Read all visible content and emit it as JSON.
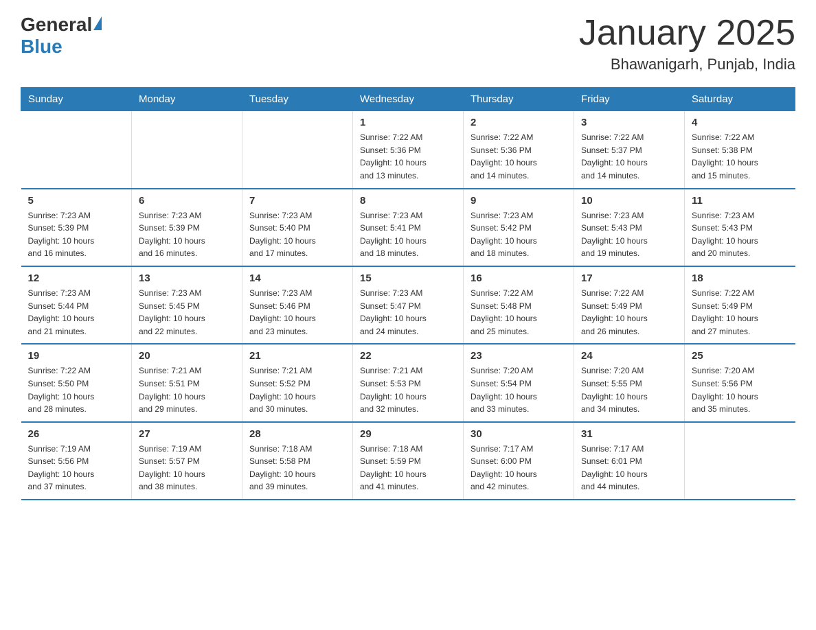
{
  "header": {
    "logo_general": "General",
    "logo_blue": "Blue",
    "month_title": "January 2025",
    "location": "Bhawanigarh, Punjab, India"
  },
  "weekdays": [
    "Sunday",
    "Monday",
    "Tuesday",
    "Wednesday",
    "Thursday",
    "Friday",
    "Saturday"
  ],
  "weeks": [
    [
      {
        "day": "",
        "info": ""
      },
      {
        "day": "",
        "info": ""
      },
      {
        "day": "",
        "info": ""
      },
      {
        "day": "1",
        "info": "Sunrise: 7:22 AM\nSunset: 5:36 PM\nDaylight: 10 hours\nand 13 minutes."
      },
      {
        "day": "2",
        "info": "Sunrise: 7:22 AM\nSunset: 5:36 PM\nDaylight: 10 hours\nand 14 minutes."
      },
      {
        "day": "3",
        "info": "Sunrise: 7:22 AM\nSunset: 5:37 PM\nDaylight: 10 hours\nand 14 minutes."
      },
      {
        "day": "4",
        "info": "Sunrise: 7:22 AM\nSunset: 5:38 PM\nDaylight: 10 hours\nand 15 minutes."
      }
    ],
    [
      {
        "day": "5",
        "info": "Sunrise: 7:23 AM\nSunset: 5:39 PM\nDaylight: 10 hours\nand 16 minutes."
      },
      {
        "day": "6",
        "info": "Sunrise: 7:23 AM\nSunset: 5:39 PM\nDaylight: 10 hours\nand 16 minutes."
      },
      {
        "day": "7",
        "info": "Sunrise: 7:23 AM\nSunset: 5:40 PM\nDaylight: 10 hours\nand 17 minutes."
      },
      {
        "day": "8",
        "info": "Sunrise: 7:23 AM\nSunset: 5:41 PM\nDaylight: 10 hours\nand 18 minutes."
      },
      {
        "day": "9",
        "info": "Sunrise: 7:23 AM\nSunset: 5:42 PM\nDaylight: 10 hours\nand 18 minutes."
      },
      {
        "day": "10",
        "info": "Sunrise: 7:23 AM\nSunset: 5:43 PM\nDaylight: 10 hours\nand 19 minutes."
      },
      {
        "day": "11",
        "info": "Sunrise: 7:23 AM\nSunset: 5:43 PM\nDaylight: 10 hours\nand 20 minutes."
      }
    ],
    [
      {
        "day": "12",
        "info": "Sunrise: 7:23 AM\nSunset: 5:44 PM\nDaylight: 10 hours\nand 21 minutes."
      },
      {
        "day": "13",
        "info": "Sunrise: 7:23 AM\nSunset: 5:45 PM\nDaylight: 10 hours\nand 22 minutes."
      },
      {
        "day": "14",
        "info": "Sunrise: 7:23 AM\nSunset: 5:46 PM\nDaylight: 10 hours\nand 23 minutes."
      },
      {
        "day": "15",
        "info": "Sunrise: 7:23 AM\nSunset: 5:47 PM\nDaylight: 10 hours\nand 24 minutes."
      },
      {
        "day": "16",
        "info": "Sunrise: 7:22 AM\nSunset: 5:48 PM\nDaylight: 10 hours\nand 25 minutes."
      },
      {
        "day": "17",
        "info": "Sunrise: 7:22 AM\nSunset: 5:49 PM\nDaylight: 10 hours\nand 26 minutes."
      },
      {
        "day": "18",
        "info": "Sunrise: 7:22 AM\nSunset: 5:49 PM\nDaylight: 10 hours\nand 27 minutes."
      }
    ],
    [
      {
        "day": "19",
        "info": "Sunrise: 7:22 AM\nSunset: 5:50 PM\nDaylight: 10 hours\nand 28 minutes."
      },
      {
        "day": "20",
        "info": "Sunrise: 7:21 AM\nSunset: 5:51 PM\nDaylight: 10 hours\nand 29 minutes."
      },
      {
        "day": "21",
        "info": "Sunrise: 7:21 AM\nSunset: 5:52 PM\nDaylight: 10 hours\nand 30 minutes."
      },
      {
        "day": "22",
        "info": "Sunrise: 7:21 AM\nSunset: 5:53 PM\nDaylight: 10 hours\nand 32 minutes."
      },
      {
        "day": "23",
        "info": "Sunrise: 7:20 AM\nSunset: 5:54 PM\nDaylight: 10 hours\nand 33 minutes."
      },
      {
        "day": "24",
        "info": "Sunrise: 7:20 AM\nSunset: 5:55 PM\nDaylight: 10 hours\nand 34 minutes."
      },
      {
        "day": "25",
        "info": "Sunrise: 7:20 AM\nSunset: 5:56 PM\nDaylight: 10 hours\nand 35 minutes."
      }
    ],
    [
      {
        "day": "26",
        "info": "Sunrise: 7:19 AM\nSunset: 5:56 PM\nDaylight: 10 hours\nand 37 minutes."
      },
      {
        "day": "27",
        "info": "Sunrise: 7:19 AM\nSunset: 5:57 PM\nDaylight: 10 hours\nand 38 minutes."
      },
      {
        "day": "28",
        "info": "Sunrise: 7:18 AM\nSunset: 5:58 PM\nDaylight: 10 hours\nand 39 minutes."
      },
      {
        "day": "29",
        "info": "Sunrise: 7:18 AM\nSunset: 5:59 PM\nDaylight: 10 hours\nand 41 minutes."
      },
      {
        "day": "30",
        "info": "Sunrise: 7:17 AM\nSunset: 6:00 PM\nDaylight: 10 hours\nand 42 minutes."
      },
      {
        "day": "31",
        "info": "Sunrise: 7:17 AM\nSunset: 6:01 PM\nDaylight: 10 hours\nand 44 minutes."
      },
      {
        "day": "",
        "info": ""
      }
    ]
  ]
}
